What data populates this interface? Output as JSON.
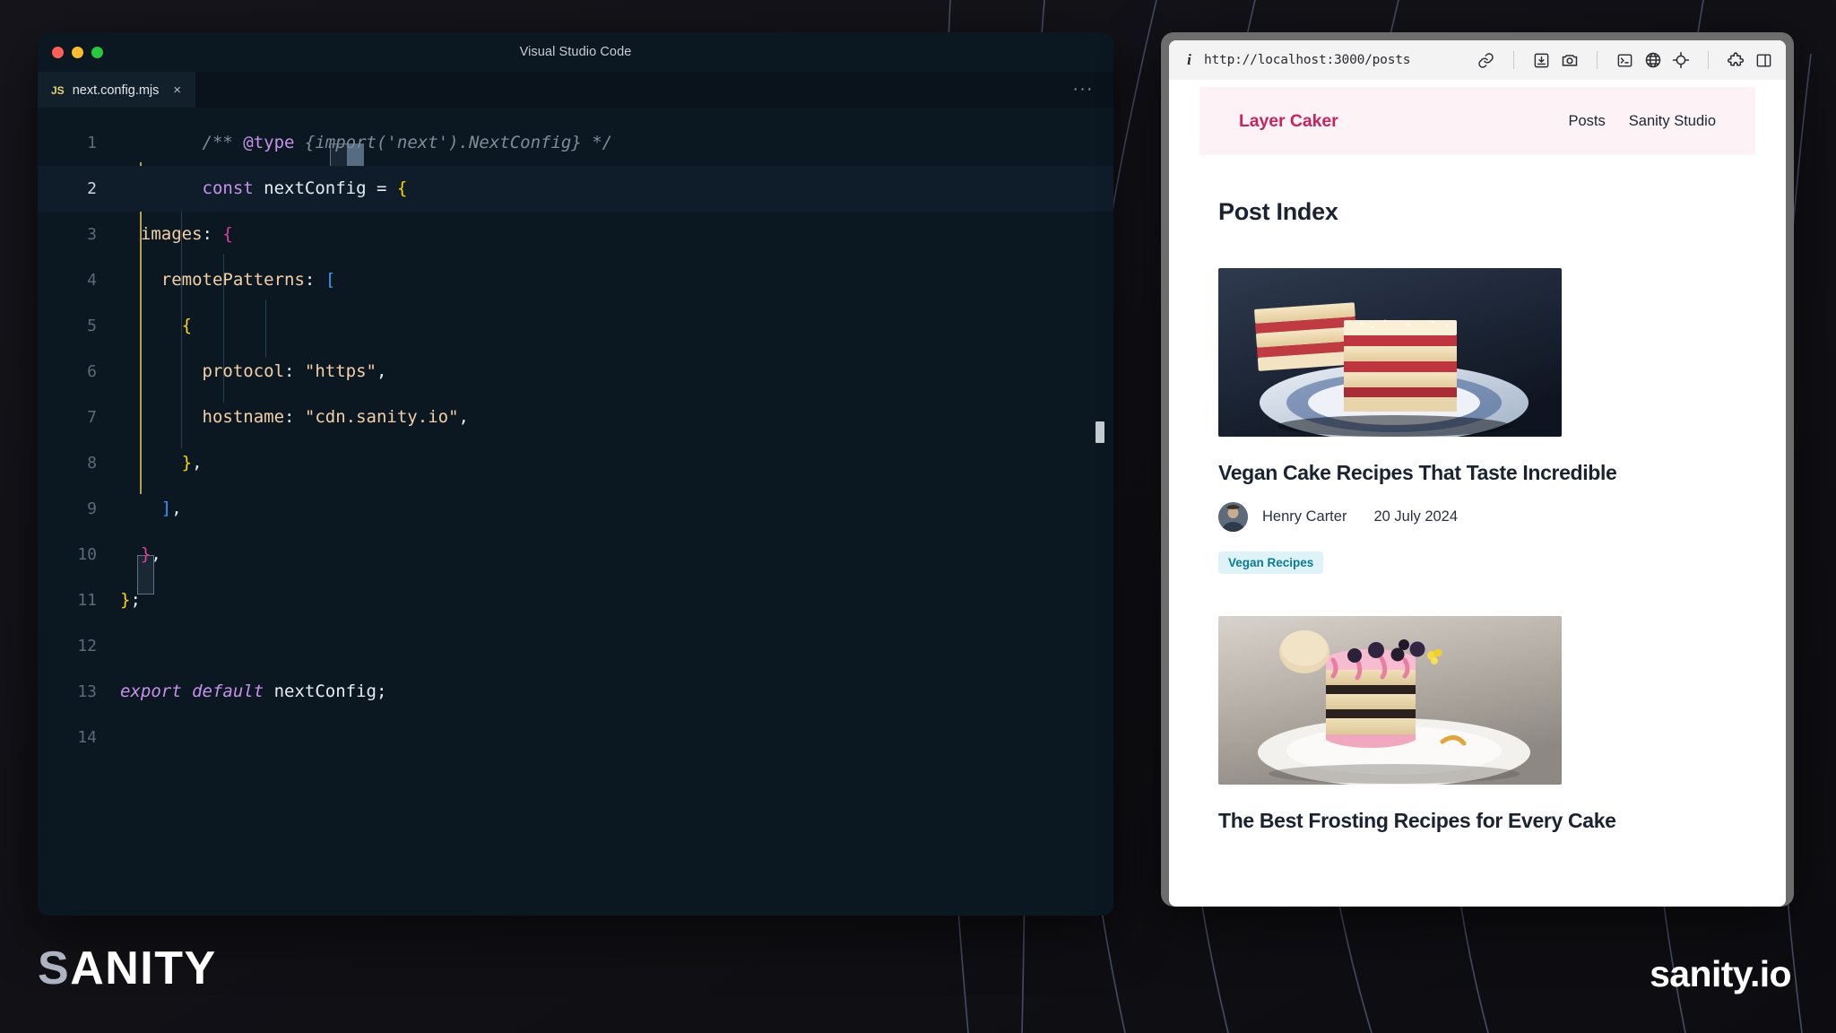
{
  "editor": {
    "window_title": "Visual Studio Code",
    "tab": {
      "filetype_badge": "JS",
      "filename": "next.config.mjs",
      "close_glyph": "×"
    },
    "overflow_glyph": "···",
    "lines": [
      {
        "no": "1",
        "text": "/** @type {import('next').NextConfig} */"
      },
      {
        "no": "2",
        "text": "const nextConfig = {"
      },
      {
        "no": "3",
        "text": "  images: {"
      },
      {
        "no": "4",
        "text": "    remotePatterns: ["
      },
      {
        "no": "5",
        "text": "      {"
      },
      {
        "no": "6",
        "text": "        protocol: \"https\","
      },
      {
        "no": "7",
        "text": "        hostname: \"cdn.sanity.io\","
      },
      {
        "no": "8",
        "text": "      },"
      },
      {
        "no": "9",
        "text": "    ],"
      },
      {
        "no": "10",
        "text": "  },"
      },
      {
        "no": "11",
        "text": "};"
      },
      {
        "no": "12",
        "text": ""
      },
      {
        "no": "13",
        "text": "export default nextConfig;"
      },
      {
        "no": "14",
        "text": ""
      }
    ],
    "line_numbers": {
      "n1": "1",
      "n2": "2",
      "n3": "3",
      "n4": "4",
      "n5": "5",
      "n6": "6",
      "n7": "7",
      "n8": "8",
      "n9": "9",
      "n10": "10",
      "n11": "11",
      "n12": "12",
      "n13": "13",
      "n14": "14"
    },
    "tokens": {
      "l1_comment_a": "/** ",
      "l1_tag": "@type",
      "l1_comment_b": " {import('next').NextConfig} */",
      "l2_const": "const",
      "l2_name": " nextConfig ",
      "l2_eq": "= ",
      "l2_brace": "{",
      "l3_prop": "images",
      "l3_colon": ": ",
      "l3_brace": "{",
      "l4_prop": "remotePatterns",
      "l4_colon": ": ",
      "l4_bracket": "[",
      "l5_brace": "{",
      "l6_prop": "protocol",
      "l6_colon": ": ",
      "l6_str": "\"https\"",
      "l6_comma": ",",
      "l7_prop": "hostname",
      "l7_colon": ": ",
      "l7_str": "\"cdn.sanity.io\"",
      "l7_comma": ",",
      "l8_brace": "}",
      "l8_comma": ",",
      "l9_bracket": "]",
      "l9_comma": ",",
      "l10_brace": "}",
      "l10_comma": ",",
      "l11_brace": "}",
      "l11_semi": ";",
      "l13_kw": "export default",
      "l13_name": " nextConfig",
      "l13_semi": ";"
    },
    "colors": {
      "background": "#0b1721",
      "active_line": "#0e1d29",
      "comment": "#7f8c9a",
      "keyword": "#c792ea",
      "property": "#f3d0a8",
      "string": "#f3d0a8",
      "bracket_yellow": "#ffd700",
      "bracket_pink": "#e040a0",
      "bracket_blue": "#3794ff"
    }
  },
  "browser": {
    "info_icon_glyph": "i",
    "url": "http://localhost:3000/posts",
    "toolbar_icons": [
      "link-icon",
      "download-inbox-icon",
      "camera-icon",
      "terminal-icon",
      "globe-icon",
      "crosshair-icon",
      "puzzle-extension-icon",
      "sidebar-panel-icon"
    ]
  },
  "site": {
    "brand": "Layer Caker",
    "nav": [
      {
        "label": "Posts"
      },
      {
        "label": "Sanity Studio"
      }
    ],
    "page_title": "Post Index",
    "posts": [
      {
        "title": "Vegan Cake Recipes That Taste Incredible",
        "author": "Henry Carter",
        "date": "20 July 2024",
        "tag": "Vegan Recipes",
        "image_alt": "stacked-layered-cake-slices-on-blue-plate"
      },
      {
        "title": "The Best Frosting Recipes for Every Cake",
        "image_alt": "frosted-layer-cake-slice-with-berries-on-plate"
      }
    ],
    "colors": {
      "brand": "#c4255e",
      "header_bg": "#fdf3f6",
      "tag_bg": "#def3f8",
      "tag_text": "#0c7a92",
      "heading": "#1b2232"
    }
  },
  "footer": {
    "logo_first": "S",
    "logo_rest": "ANITY",
    "domain": "sanity.io"
  }
}
